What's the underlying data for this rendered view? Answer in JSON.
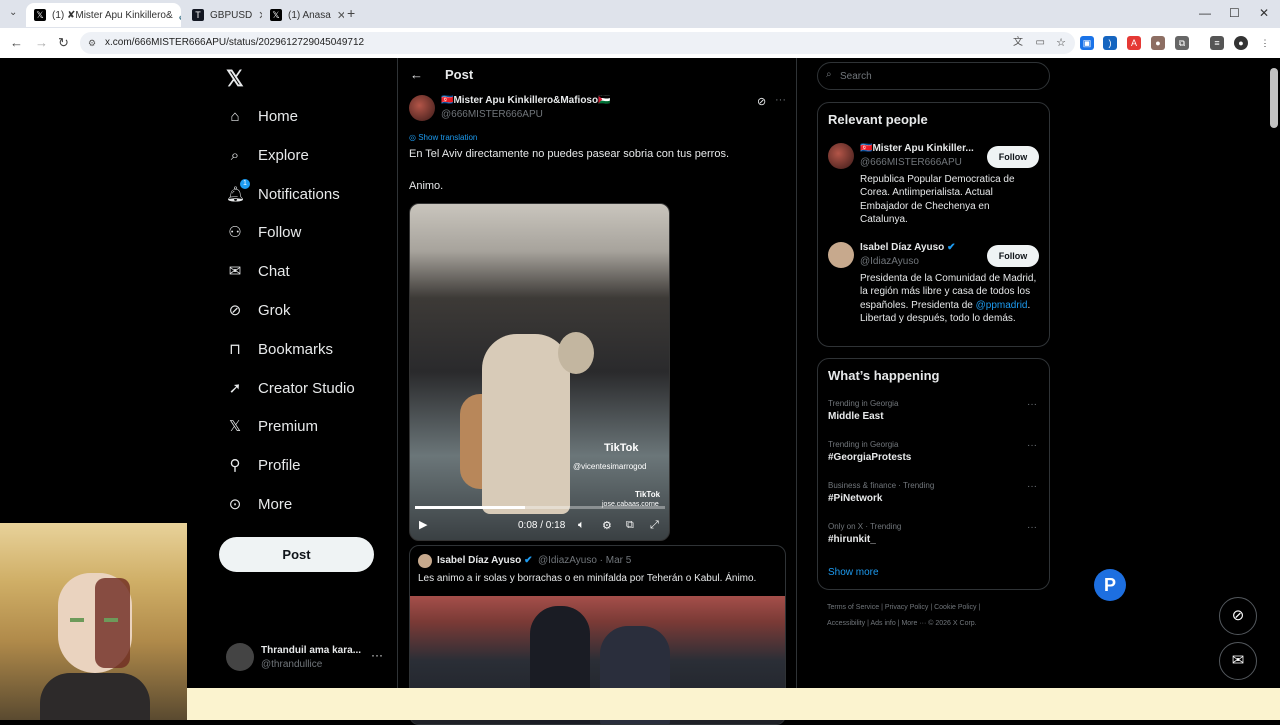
{
  "browser": {
    "tabs": [
      {
        "title": "(1) ✘Mister Apu Kinkillero&",
        "active": true
      },
      {
        "title": "GBPUSD",
        "active": false
      },
      {
        "title": "(1) Anasa",
        "active": false
      }
    ],
    "url": "x.com/666MISTER666APU/status/2029612729045049712"
  },
  "nav": {
    "items": [
      {
        "label": "Home",
        "icon": "home-icon"
      },
      {
        "label": "Explore",
        "icon": "search-icon"
      },
      {
        "label": "Notifications",
        "icon": "bell-icon"
      },
      {
        "label": "Follow",
        "icon": "person-add-icon"
      },
      {
        "label": "Chat",
        "icon": "mail-icon"
      },
      {
        "label": "Grok",
        "icon": "grok-icon"
      },
      {
        "label": "Bookmarks",
        "icon": "bookmark-icon"
      },
      {
        "label": "Creator Studio",
        "icon": "rocket-icon"
      },
      {
        "label": "Premium",
        "icon": "x-icon"
      },
      {
        "label": "Profile",
        "icon": "person-icon"
      },
      {
        "label": "More",
        "icon": "more-circle-icon"
      }
    ],
    "notif_badge": "1",
    "post_button": "Post",
    "account": {
      "name": "Thranduil ama kara...",
      "handle": "@thrandullice"
    }
  },
  "post": {
    "header": "Post",
    "author_name": "🇰🇵Mister Apu Kinkillero&Mafioso🇵🇸",
    "author_handle": "@666MISTER666APU",
    "show_translation": "Show translation",
    "text_line1": "En Tel Aviv directamente no puedes pasear sobria con tus perros.",
    "text_line2": "Animo.",
    "video": {
      "tiktok_logo": "TikTok",
      "tiktok_user": "@vicentesimarrogod",
      "tiktok_logo2": "TikTok",
      "tiktok_user2": "jose.cabaas.corne",
      "time": "0:08 / 0:18",
      "progress": 0.44
    },
    "quote": {
      "name": "Isabel Díaz Ayuso",
      "meta": "@IdiazAyuso · Mar 5",
      "text": "Les animo a ir solas y borrachas o en minifalda por Teherán o Kabul. Ánimo."
    }
  },
  "right": {
    "search_placeholder": "Search",
    "relevant_title": "Relevant people",
    "people": [
      {
        "name": "🇰🇵Mister Apu Kinkiller...",
        "handle": "@666MISTER666APU",
        "bio": "Republica Popular Democratica de Corea. Antiimperialista. Actual Embajador de Chechenya en Catalunya.",
        "follow": "Follow"
      },
      {
        "name": "Isabel Díaz Ayuso",
        "handle": "@IdiazAyuso",
        "bio_pre": "Presidenta de la Comunidad de Madrid, la región más libre y casa de todos los españoles. Presidenta de ",
        "bio_link": "@ppmadrid",
        "bio_post": ". Libertad y después, todo lo demás.",
        "follow": "Follow"
      }
    ],
    "happening_title": "What’s happening",
    "trends": [
      {
        "meta": "Trending in Georgia",
        "name": "Middle East"
      },
      {
        "meta": "Trending in Georgia",
        "name": "#GeorgiaProtests"
      },
      {
        "meta": "Business & finance · Trending",
        "name": "#PiNetwork"
      },
      {
        "meta": "Only on X · Trending",
        "name": "#hirunkit_"
      }
    ],
    "show_more": "Show more",
    "footer_line1": "Terms of Service  |  Privacy Policy  |  Cookie Policy  |",
    "footer_line2": "Accessibility  |  Ads info  |  More ···  © 2026 X Corp."
  }
}
